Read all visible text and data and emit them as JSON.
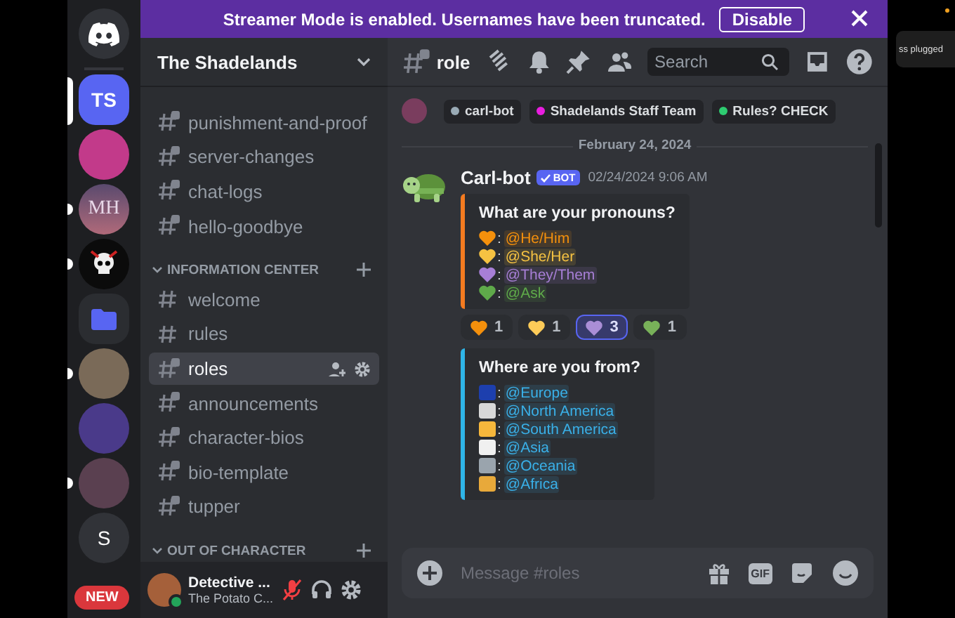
{
  "banner": {
    "text": "Streamer Mode is enabled. Usernames have been truncated.",
    "button": "Disable"
  },
  "toast": {
    "text": "ss plugged"
  },
  "servers": [
    {
      "kind": "home",
      "selected": false,
      "unread": false
    },
    {
      "kind": "initials",
      "label": "TS",
      "selected": true
    },
    {
      "kind": "image",
      "selected": false,
      "unread": false,
      "color": "#c23a8a"
    },
    {
      "kind": "initials-image",
      "label": "MH",
      "selected": false,
      "unread": true
    },
    {
      "kind": "skull-image",
      "selected": false,
      "unread": true,
      "color": "#0b0b0b"
    },
    {
      "kind": "folder",
      "selected": false,
      "unread": false
    },
    {
      "kind": "image",
      "selected": false,
      "unread": true,
      "color": "#7a6a58"
    },
    {
      "kind": "image",
      "selected": false,
      "unread": false,
      "color": "#4a3a8a"
    },
    {
      "kind": "image",
      "selected": false,
      "unread": true,
      "color": "#5a4050"
    },
    {
      "kind": "letter",
      "label": "S",
      "selected": false,
      "unread": false
    }
  ],
  "new_badge": "NEW",
  "server_name": "The Shadelands",
  "channels": [
    {
      "name": "punishment-and-proof",
      "selected": false,
      "locked": true
    },
    {
      "name": "server-changes",
      "selected": false,
      "locked": true
    },
    {
      "name": "chat-logs",
      "selected": false,
      "locked": true
    },
    {
      "name": "hello-goodbye",
      "selected": false,
      "locked": true
    }
  ],
  "categories": [
    {
      "name": "INFORMATION CENTER",
      "expanded": true,
      "children": [
        {
          "name": "welcome",
          "selected": false,
          "locked": false
        },
        {
          "name": "rules",
          "selected": false,
          "locked": false
        },
        {
          "name": "roles",
          "selected": true,
          "locked": true
        },
        {
          "name": "announcements",
          "selected": false,
          "locked": true
        },
        {
          "name": "character-bios",
          "selected": false,
          "locked": true
        },
        {
          "name": "bio-template",
          "selected": false,
          "locked": true
        },
        {
          "name": "tupper",
          "selected": false,
          "locked": true
        }
      ]
    },
    {
      "name": "OUT OF CHARACTER",
      "expanded": true
    }
  ],
  "user": {
    "name": "Detective ...",
    "status": "The Potato C...",
    "mic_muted": true
  },
  "header": {
    "channel": "role",
    "search_placeholder": "Search"
  },
  "role_tags": [
    {
      "label": "carl-bot",
      "color": "#99aab5"
    },
    {
      "label": "Shadelands Staff Team",
      "color": "#e91ee0"
    },
    {
      "label": "Rules? CHECK",
      "color": "#2ecc71"
    }
  ],
  "date_divider": "February 24, 2024",
  "message": {
    "author": "Carl-bot",
    "badge": "BOT",
    "time": "02/24/2024 9:06 AM",
    "embeds": [
      {
        "title": "What are your pronouns?",
        "color": "#f47b20",
        "items": [
          {
            "kind": "heart",
            "separator": ":",
            "role": "@He/Him",
            "color": "#f4900c"
          },
          {
            "kind": "heart",
            "separator": ":",
            "role": "@She/Her",
            "color": "#f5c242"
          },
          {
            "kind": "heart",
            "separator": ":",
            "role": "@They/Them",
            "color": "#a77fd6"
          },
          {
            "kind": "heart",
            "separator": ":",
            "role": "@Ask",
            "color": "#5faa4a"
          }
        ],
        "reactions": [
          {
            "color": "#f4900c",
            "count": "1",
            "selected": false
          },
          {
            "color": "#fdcb58",
            "count": "1",
            "selected": false
          },
          {
            "color": "#aa8ed6",
            "count": "3",
            "selected": true
          },
          {
            "color": "#78b159",
            "count": "1",
            "selected": false
          }
        ]
      },
      {
        "title": "Where are you from?",
        "color": "#2fb5e8",
        "items": [
          {
            "kind": "flag",
            "separator": ":",
            "role": "@Europe",
            "color": "#3ab0e8"
          },
          {
            "kind": "eagle",
            "separator": ":",
            "role": "@North America",
            "color": "#3ab0e8"
          },
          {
            "kind": "sunrise",
            "separator": ":",
            "role": "@South America",
            "color": "#3ab0e8"
          },
          {
            "kind": "panda",
            "separator": ":",
            "role": "@Asia",
            "color": "#3ab0e8"
          },
          {
            "kind": "koala",
            "separator": ":",
            "role": "@Oceania",
            "color": "#3ab0e8"
          },
          {
            "kind": "giraffe",
            "separator": ":",
            "role": "@Africa",
            "color": "#3ab0e8"
          }
        ]
      }
    ]
  },
  "composer": {
    "placeholder": "Message #roles",
    "gif": "GIF"
  }
}
